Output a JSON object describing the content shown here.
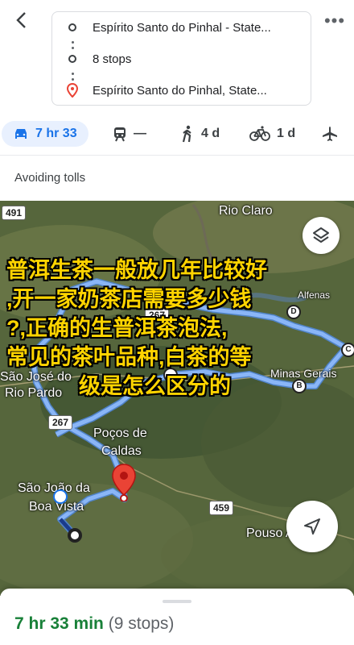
{
  "header": {
    "origin": "Espírito Santo do Pinhal - State...",
    "stops": "8 stops",
    "destination": "Espírito Santo do Pinhal, State..."
  },
  "modes": [
    {
      "name": "drive",
      "label": "7 hr 33",
      "icon": "car-icon",
      "active": true
    },
    {
      "name": "transit",
      "label": "—",
      "icon": "train-icon"
    },
    {
      "name": "walk",
      "label": "4 d",
      "icon": "walking-icon"
    },
    {
      "name": "bike",
      "label": "1 d",
      "icon": "bicycle-icon"
    },
    {
      "name": "flight",
      "label": "",
      "icon": "airplane-icon"
    }
  ],
  "avoid_text": "Avoiding tolls",
  "map": {
    "labels": {
      "rio_claro": "Rio Claro",
      "sao_jose": "São José do",
      "rio_pardo": "Rio Pardo",
      "pocos1": "Poços de",
      "pocos2": "Caldas",
      "sjbv1": "São João da",
      "sjbv2": "Boa Vista",
      "pouso": "Pouso Alegre",
      "alfenas": "Alfenas",
      "minas": "Minas Gerais"
    },
    "roads": {
      "r491": "491",
      "r267a": "267",
      "r267b": "267",
      "r459": "459"
    },
    "waypoints": {
      "b": "B",
      "c": "C",
      "d": "D"
    },
    "overlay_lines": [
      "普洱生茶一般放几年比较好",
      ",开一家奶茶店需要多少钱",
      "?,正确的生普洱茶泡法,",
      "常见的茶叶品种,白茶的等",
      "级是怎么区分的"
    ]
  },
  "summary": {
    "duration": "7 hr 33 min",
    "stops": "(9 stops)"
  },
  "colors": {
    "accent": "#1a73e8",
    "route": "#7fb0f5",
    "duration": "#188038",
    "overlay_text": "#ffd400"
  }
}
